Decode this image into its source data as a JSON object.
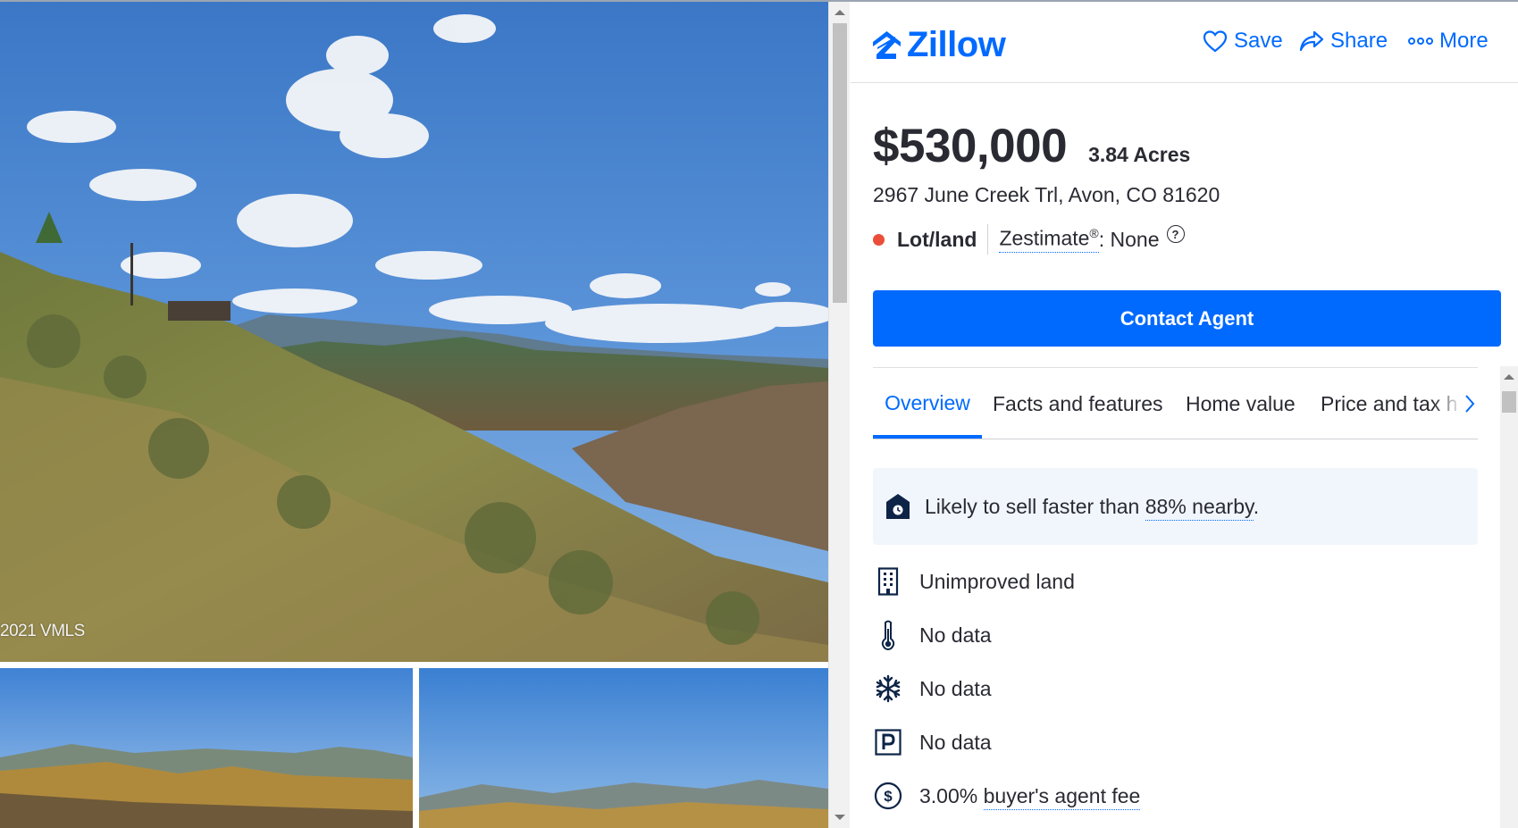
{
  "photos": {
    "copyright": "2021 VMLS"
  },
  "header": {
    "logo_text": "Zillow",
    "save_label": "Save",
    "share_label": "Share",
    "more_label": "More"
  },
  "listing": {
    "price": "$530,000",
    "acres": "3.84 Acres",
    "address": "2967 June Creek Trl, Avon, CO 81620",
    "status": "Lot/land",
    "status_color": "#ea4e39",
    "zestimate_label": "Zestimate",
    "zestimate_mark": "®",
    "zestimate_value": ": None",
    "zestimate_help": "?"
  },
  "contact_button": "Contact Agent",
  "tabs": [
    "Overview",
    "Facts and features",
    "Home value",
    "Price and tax h"
  ],
  "insight": {
    "prefix": "Likely to sell faster than ",
    "link": "88% nearby",
    "suffix": "."
  },
  "facts": [
    {
      "icon": "building-icon",
      "text": "Unimproved land"
    },
    {
      "icon": "thermometer-icon",
      "text": "No data"
    },
    {
      "icon": "snowflake-icon",
      "text": "No data"
    },
    {
      "icon": "parking-icon",
      "text": "No data"
    },
    {
      "icon": "dollar-icon",
      "text": "3.00% ",
      "link": "buyer's agent fee"
    }
  ],
  "colors": {
    "brand": "#006aff",
    "text": "#2a2a33"
  }
}
